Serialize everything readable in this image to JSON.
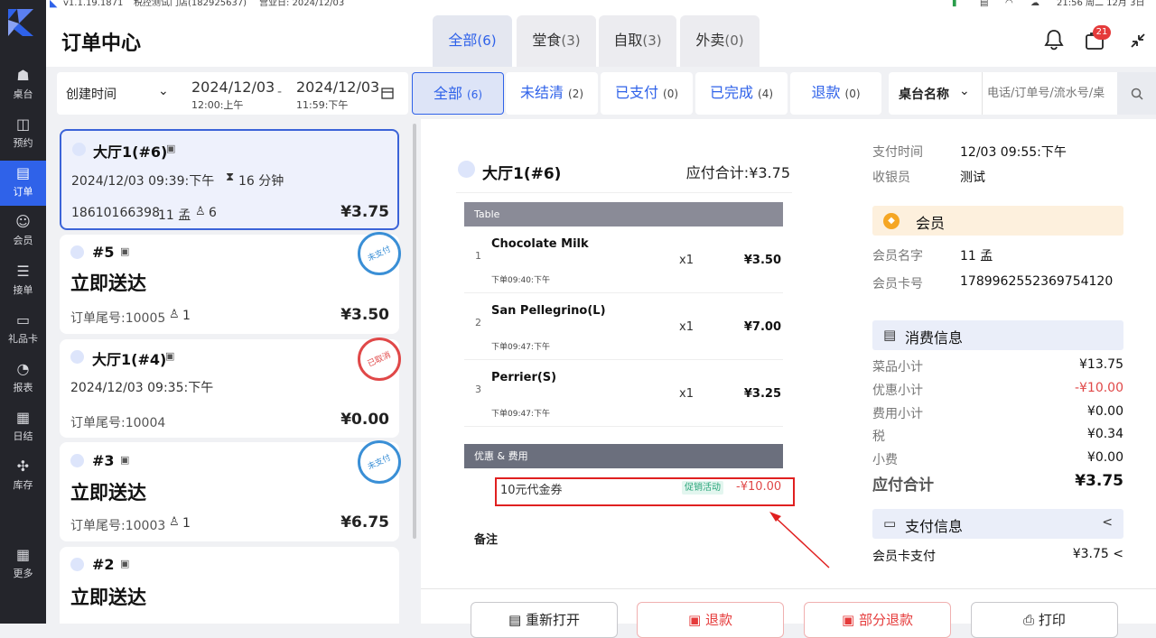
{
  "statusbar": {
    "version": "v1.1.19.1871",
    "store": "税控测试门店(182925637)",
    "business_day": "营业日: 2024/12/03",
    "clock": "21:56 周二 12月 3日"
  },
  "rail": {
    "items": [
      {
        "label": "桌台",
        "icon": "table-icon"
      },
      {
        "label": "预约",
        "icon": "reservation-icon"
      },
      {
        "label": "订单",
        "icon": "order-icon"
      },
      {
        "label": "会员",
        "icon": "member-icon"
      },
      {
        "label": "接单",
        "icon": "accept-order-icon"
      },
      {
        "label": "礼品卡",
        "icon": "gift-card-icon"
      },
      {
        "label": "报表",
        "icon": "report-icon"
      },
      {
        "label": "日结",
        "icon": "daily-settle-icon"
      },
      {
        "label": "库存",
        "icon": "inventory-icon"
      },
      {
        "label": "更多",
        "icon": "more-icon"
      }
    ],
    "accent": "#2f62e9"
  },
  "header": {
    "title": "订单中心",
    "tabs": [
      {
        "label": "全部",
        "count": "(6)"
      },
      {
        "label": "堂食",
        "count": "(3)"
      },
      {
        "label": "自取",
        "count": "(3)"
      },
      {
        "label": "外卖",
        "count": "(0)"
      }
    ],
    "notification_count": "21"
  },
  "filter": {
    "time_type": "创建时间",
    "start_date": "2024/12/03",
    "start_time": "12:00:上午",
    "separator": "-",
    "end_date": "2024/12/03",
    "end_time": "11:59:下午",
    "status_tabs": [
      {
        "label": "全部",
        "count": "(6)"
      },
      {
        "label": "未结清",
        "count": "(2)"
      },
      {
        "label": "已支付",
        "count": "(0)"
      },
      {
        "label": "已完成",
        "count": "(4)"
      },
      {
        "label": "退款",
        "count": "(0)"
      }
    ],
    "search_type": "桌台名称",
    "search_placeholder": "电话/订单号/流水号/桌"
  },
  "orders": [
    {
      "name": "大厅1(#6)",
      "time": "2024/12/03 09:39:下午",
      "duration": "16 分钟",
      "phone": "18610166398",
      "member": "11 孟",
      "guests": "6",
      "price": "¥3.75"
    },
    {
      "name": "#5",
      "title": "立即送达",
      "tail": "订单尾号:10005",
      "guests": "1",
      "price": "¥3.50",
      "stamp": "未支付"
    },
    {
      "name": "大厅1(#4)",
      "time": "2024/12/03 09:35:下午",
      "tail": "订单尾号:10004",
      "price": "¥0.00",
      "stamp": "已取消"
    },
    {
      "name": "#3",
      "title": "立即送达",
      "tail": "订单尾号:10003",
      "guests": "1",
      "price": "¥6.75",
      "stamp": "未支付"
    },
    {
      "name": "#2",
      "title": "立即送达"
    }
  ],
  "receipt": {
    "table_name": "大厅1(#6)",
    "total_label": "应付合计:¥3.75",
    "section_items": "Table",
    "items": [
      {
        "idx": "1",
        "name": "Chocolate Milk",
        "time": "下单09:40:下午",
        "qty": "x1",
        "price": "¥3.50"
      },
      {
        "idx": "2",
        "name": "San Pellegrino(L)",
        "time": "下单09:47:下午",
        "qty": "x1",
        "price": "¥7.00"
      },
      {
        "idx": "3",
        "name": "Perrier(S)",
        "time": "下单09:47:下午",
        "qty": "x1",
        "price": "¥3.25"
      }
    ],
    "section_discount": "优惠 & 费用",
    "discount": {
      "name": "10元代金券",
      "tag": "促销活动",
      "amount": "-¥10.00"
    },
    "remark_label": "备注"
  },
  "info": {
    "pay_time_label": "支付时间",
    "pay_time": "12/03 09:55:下午",
    "cashier_label": "收银员",
    "cashier": "测试",
    "member_title": "会员",
    "member_name_label": "会员名字",
    "member_name": "11 孟",
    "member_card_label": "会员卡号",
    "member_card": "1789962552369754120",
    "consume_title": "消费信息",
    "rows": [
      {
        "label": "菜品小计",
        "value": "¥13.75"
      },
      {
        "label": "优惠小计",
        "value": "-¥10.00"
      },
      {
        "label": "费用小计",
        "value": "¥0.00"
      },
      {
        "label": "税",
        "value": "¥0.34"
      },
      {
        "label": "小费",
        "value": "¥0.00"
      }
    ],
    "total_label": "应付合计",
    "total": "¥3.75",
    "pay_title": "支付信息",
    "pay_toggle": "<",
    "pay_method": "会员卡支付",
    "pay_amount": "¥3.75 <"
  },
  "actions": {
    "reopen": "重新打开",
    "refund": "退款",
    "partial_refund": "部分退款",
    "print": "打印"
  }
}
